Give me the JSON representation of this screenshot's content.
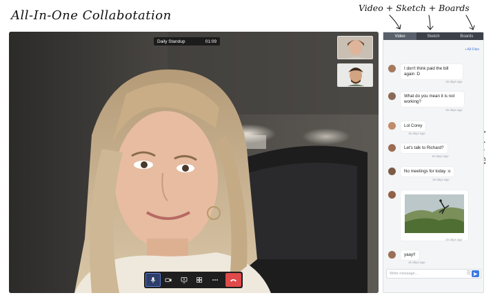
{
  "headline": "All-In-One Collabotation",
  "annotations": {
    "top": "Video + Sketch + Boards",
    "side": "chat + files"
  },
  "call": {
    "title": "Daily Standup",
    "timer": "01:09"
  },
  "panel": {
    "tabs": [
      {
        "label": "Video"
      },
      {
        "label": "Sketch"
      },
      {
        "label": "Boards"
      }
    ],
    "all_files": "All Files",
    "messages": [
      {
        "text": "I don't think paid the bill again :D",
        "time": "16 days ago"
      },
      {
        "text": "What do you mean it is not working?",
        "time": "16 days ago"
      },
      {
        "text": "Lol Corey",
        "time": "16 days ago"
      },
      {
        "text": "Let's talk to Richard?",
        "time": "16 days ago"
      },
      {
        "text": "No meetings for today :o",
        "time": "16 days ago"
      },
      {
        "text": "",
        "time": "16 days ago"
      },
      {
        "text": "yaay!!",
        "time": "16 days ago"
      }
    ],
    "composer_placeholder": "Write message..."
  },
  "colors": {
    "accent": "#3d7be0",
    "end_call": "#e04a4a",
    "tab_bar": "#3b4049"
  }
}
